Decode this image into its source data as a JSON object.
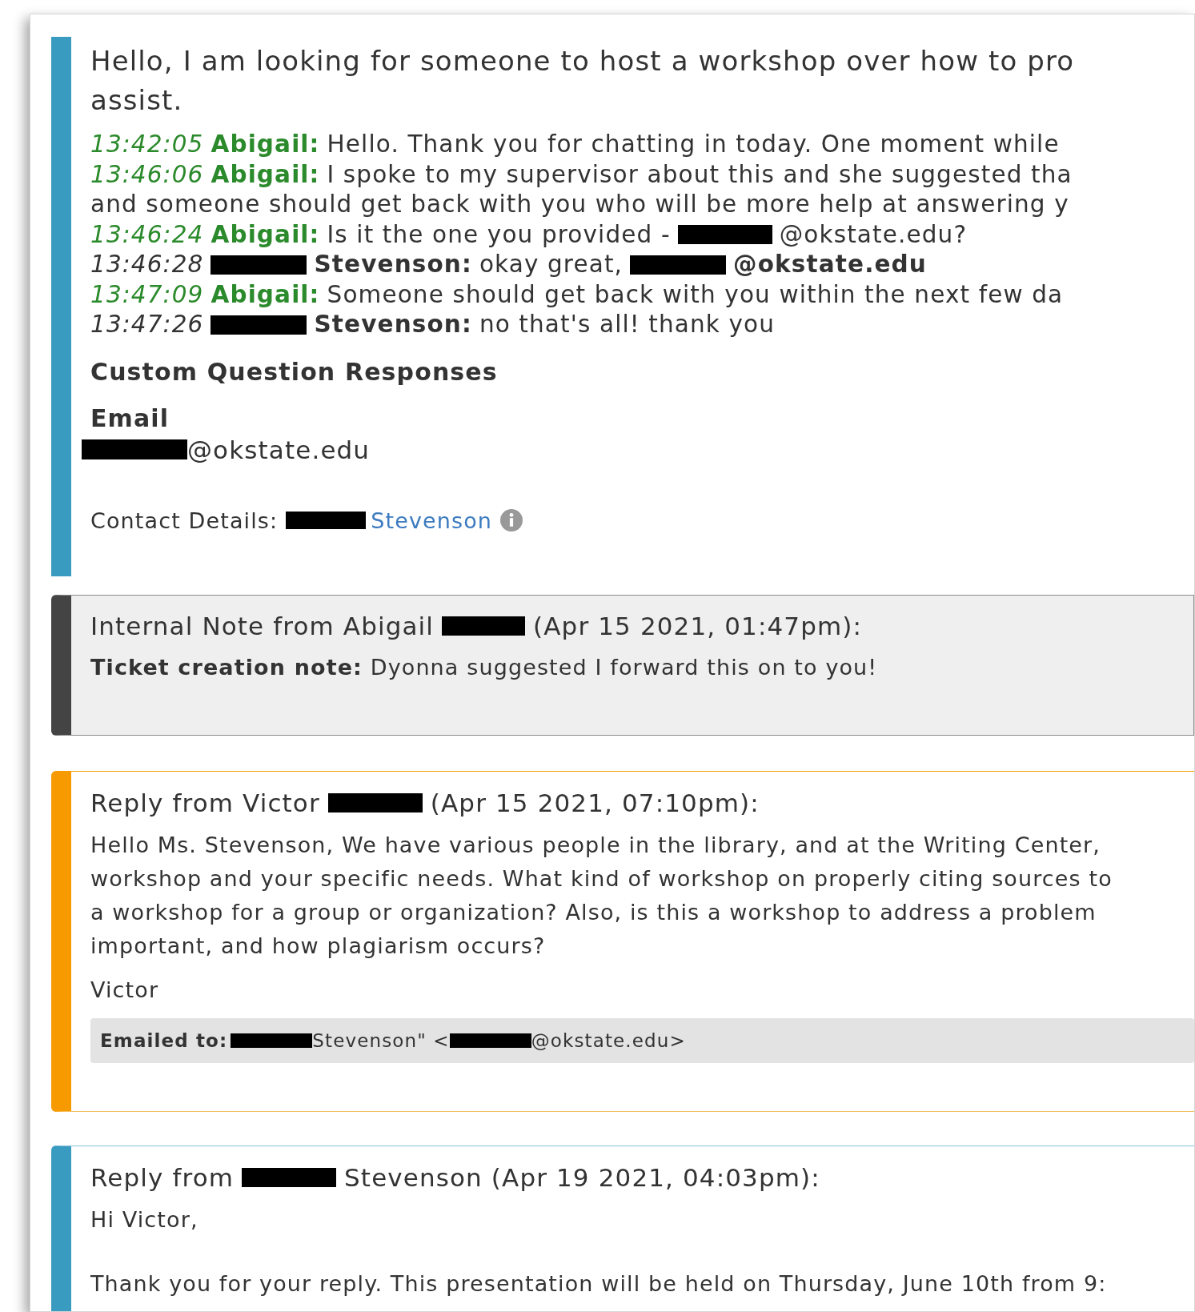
{
  "entries": [
    {
      "kind": "transcript",
      "question": [
        "Hello, I am looking for someone to host a workshop over how to pro",
        "assist."
      ],
      "messages": [
        {
          "time": "13:42:05",
          "kind": "agent",
          "speaker": [
            {
              "kind": "text",
              "text": "Abigail:"
            }
          ],
          "lines": [
            [
              {
                "kind": "text",
                "text": "Hello. Thank you for chatting in today. One moment while"
              }
            ]
          ]
        },
        {
          "time": "13:46:06",
          "kind": "agent",
          "speaker": [
            {
              "kind": "text",
              "text": "Abigail:"
            }
          ],
          "lines": [
            [
              {
                "kind": "text",
                "text": "I spoke to my supervisor about this and she suggested tha"
              }
            ],
            [
              {
                "kind": "text",
                "text": "and someone should get back with you who will be more help at answering y"
              }
            ]
          ]
        },
        {
          "time": "13:46:24",
          "kind": "agent",
          "speaker": [
            {
              "kind": "text",
              "text": "Abigail:"
            }
          ],
          "lines": [
            [
              {
                "kind": "text",
                "text": "Is it the one you provided -"
              },
              {
                "kind": "redacted"
              },
              {
                "kind": "text",
                "text": "@okstate.edu?"
              }
            ]
          ]
        },
        {
          "time": "13:46:28",
          "kind": "customer",
          "speaker": [
            {
              "kind": "redacted"
            },
            {
              "kind": "text",
              "text": "Stevenson:"
            }
          ],
          "lines": [
            [
              {
                "kind": "text",
                "text": "okay great,"
              },
              {
                "kind": "redacted"
              },
              {
                "kind": "text",
                "text": "@okstate.edu"
              }
            ]
          ]
        },
        {
          "time": "13:47:09",
          "kind": "agent",
          "speaker": [
            {
              "kind": "text",
              "text": "Abigail:"
            }
          ],
          "lines": [
            [
              {
                "kind": "text",
                "text": "Someone should get back with you within the next few da"
              }
            ]
          ]
        },
        {
          "time": "13:47:26",
          "kind": "customer",
          "speaker": [
            {
              "kind": "redacted"
            },
            {
              "kind": "text",
              "text": "Stevenson:"
            }
          ],
          "lines": [
            [
              {
                "kind": "text",
                "text": "no that's all! thank you"
              }
            ]
          ]
        }
      ],
      "custom_heading": "Custom Question Responses",
      "responses": [
        {
          "label": "Email",
          "value": [
            {
              "kind": "redacted"
            },
            {
              "kind": "text",
              "text": "@okstate.edu"
            }
          ]
        }
      ],
      "contact": {
        "label": "Contact Details:",
        "name": [
          {
            "kind": "redacted"
          },
          {
            "kind": "link",
            "text": "Stevenson"
          }
        ]
      }
    },
    {
      "kind": "internal_note",
      "heading": [
        {
          "kind": "text",
          "text": "Internal Note from Abigail"
        },
        {
          "kind": "redacted"
        },
        {
          "kind": "text",
          "text": "(Apr 15 2021, 01:47pm):"
        }
      ],
      "body": [
        "**Ticket creation note:** Dyonna suggested I forward this on to you!"
      ]
    },
    {
      "kind": "staff_reply",
      "heading": [
        {
          "kind": "text",
          "text": "Reply from Victor"
        },
        {
          "kind": "redacted"
        },
        {
          "kind": "text",
          "text": "(Apr 15 2021, 07:10pm):"
        }
      ],
      "body": [
        "Hello Ms. Stevenson, We have various people in the library, and at the Writing Center,",
        "workshop and your specific needs. What kind of workshop on properly citing sources to",
        "a workshop for a group or organization? Also, is this a workshop to address a problem",
        "important, and how plagiarism occurs?"
      ],
      "signature": "Victor",
      "emailed_to": {
        "label": "Emailed to:",
        "value": [
          {
            "kind": "redacted"
          },
          {
            "kind": "text",
            "text": "Stevenson\" <"
          },
          {
            "kind": "redacted"
          },
          {
            "kind": "text",
            "text": "@okstate.edu>"
          }
        ]
      }
    },
    {
      "kind": "customer_reply",
      "heading": [
        {
          "kind": "text",
          "text": "Reply from"
        },
        {
          "kind": "redacted"
        },
        {
          "kind": "text",
          "text": "Stevenson (Apr 19 2021, 04:03pm):"
        }
      ],
      "body": [
        "Hi Victor,",
        "Thank you for your reply. This presentation will be held on Thursday, June 10th from 9:"
      ]
    }
  ]
}
